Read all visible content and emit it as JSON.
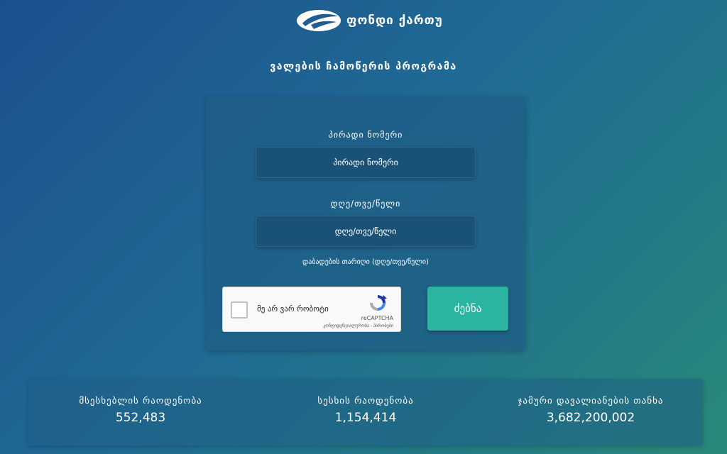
{
  "brand": {
    "name": "ფონდი ქართუ",
    "logo_icon": "kartu-swoosh-icon"
  },
  "page_title": "ვალების ჩამოწერის პროგრამა",
  "form": {
    "personal_id": {
      "label": "პირადი ნომერი",
      "placeholder": "პირადი ნომერი"
    },
    "birth_date": {
      "label": "დღე/თვე/წელი",
      "placeholder": "დღე/თვე/წელი",
      "hint": "დაბადების თარიღი (დღე/თვე/წელი)"
    },
    "recaptcha": {
      "label": "მე არ ვარ რობოტი",
      "brand": "reCAPTCHA",
      "links": "კონფიდენციალურობა - პირობები",
      "icon": "recaptcha-logo-icon"
    },
    "search_label": "ძებნა"
  },
  "stats": [
    {
      "label": "მსესხებლის რაოდენობა",
      "value": "552,483"
    },
    {
      "label": "სესხის რაოდენობა",
      "value": "1,154,414"
    },
    {
      "label": "ჯამური დავალიანების თანხა",
      "value": "3,682,200,002"
    }
  ],
  "colors": {
    "accent": "#2bb5a0",
    "background_start": "#1d4f8f",
    "background_end": "#2a8a79"
  }
}
